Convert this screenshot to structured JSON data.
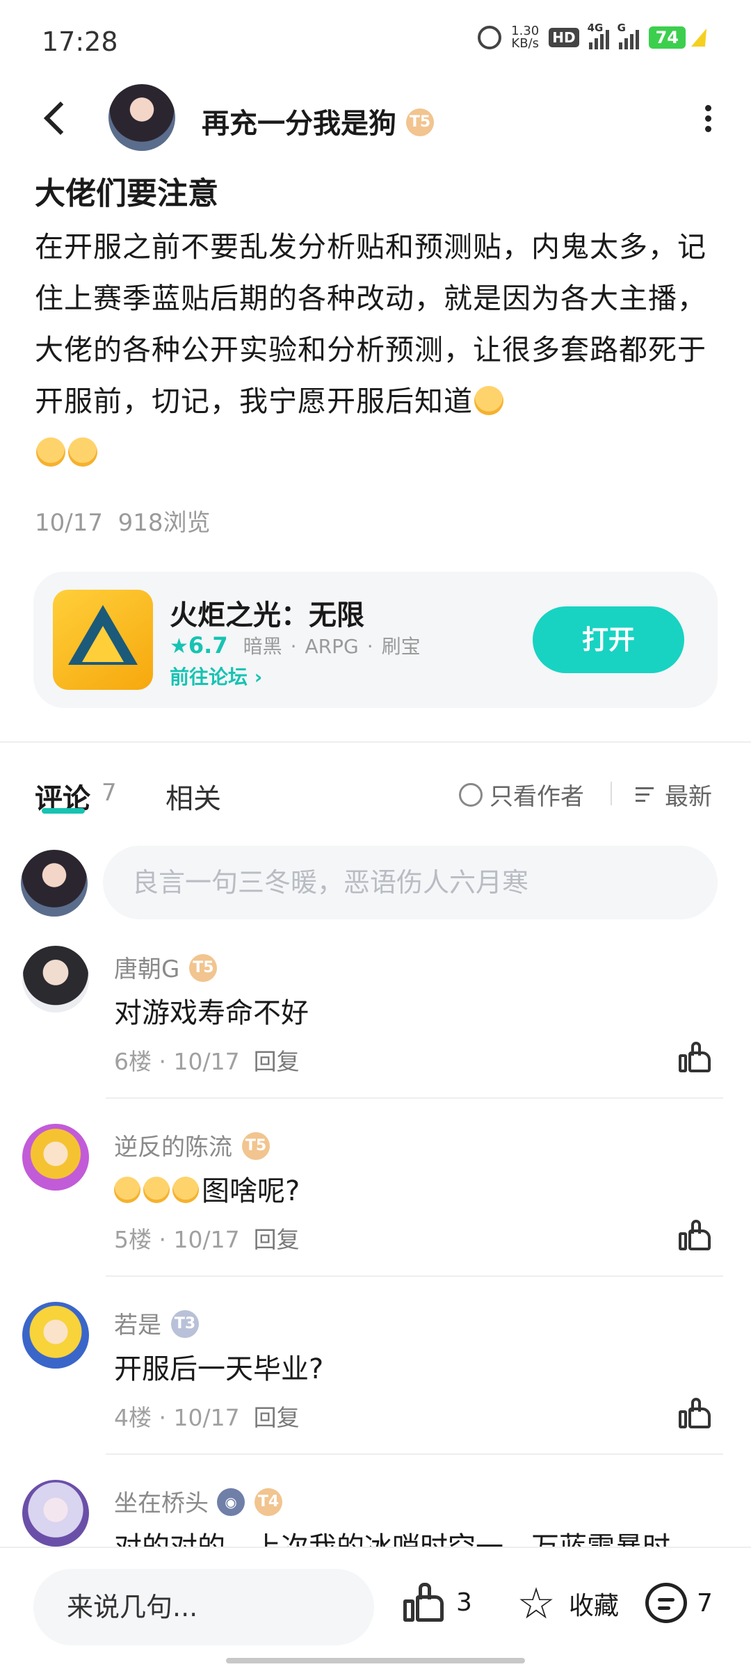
{
  "status_bar": {
    "time": "17:28",
    "net_speed": "1.30",
    "net_unit": "KB/s",
    "hd": "HD",
    "sig1": "4G",
    "sig2": "G",
    "battery": "74",
    "alarm_icon": "alarm-icon",
    "charging_icon": "bolt-icon"
  },
  "header": {
    "author_name": "再充一分我是狗",
    "author_level": "T5"
  },
  "post": {
    "title": "大佬们要注意",
    "body": "在开服之前不要乱发分析贴和预测贴，内鬼太多，记住上赛季蓝贴后期的各种改动，就是因为各大主播，大佬的各种公开实验和分析预测，让很多套路都死于开服前，切记，我宁愿开服后知道",
    "date": "10/17",
    "views": "918浏览"
  },
  "game_card": {
    "name": "火炬之光：无限",
    "score": "6.7",
    "tags": [
      "暗黑",
      "ARPG",
      "刷宝"
    ],
    "forum_link": "前往论坛",
    "open_label": "打开"
  },
  "tabs": {
    "comments_label": "评论",
    "comments_count": "7",
    "related_label": "相关",
    "only_author": "只看作者",
    "sort": "最新"
  },
  "comment_input": {
    "placeholder": "良言一句三冬暖，恶语伤人六月寒"
  },
  "comments": [
    {
      "name": "唐朝G",
      "level": "T5",
      "text": "对游戏寿命不好",
      "floor": "6楼",
      "date": "10/17",
      "reply": "回复"
    },
    {
      "name": "逆反的陈流",
      "level": "T5",
      "text": "图啥呢?",
      "floor": "5楼",
      "date": "10/17",
      "reply": "回复"
    },
    {
      "name": "若是",
      "level": "T3",
      "text": "开服后一天毕业?",
      "floor": "4楼",
      "date": "10/17",
      "reply": "回复"
    },
    {
      "name": "坐在桥头",
      "level": "T4",
      "text": "对的对的，上次我的冰哨时空一，万蓝雷暴时"
    }
  ],
  "bottom_bar": {
    "say_placeholder": "来说几句...",
    "like_count": "3",
    "fav_label": "收藏",
    "comment_count": "7"
  },
  "colors": {
    "accent": "#17c3b2",
    "open_button": "#18d3c2",
    "badge_gold": "#f2c48f",
    "badge_silver": "#b9c1d8"
  }
}
